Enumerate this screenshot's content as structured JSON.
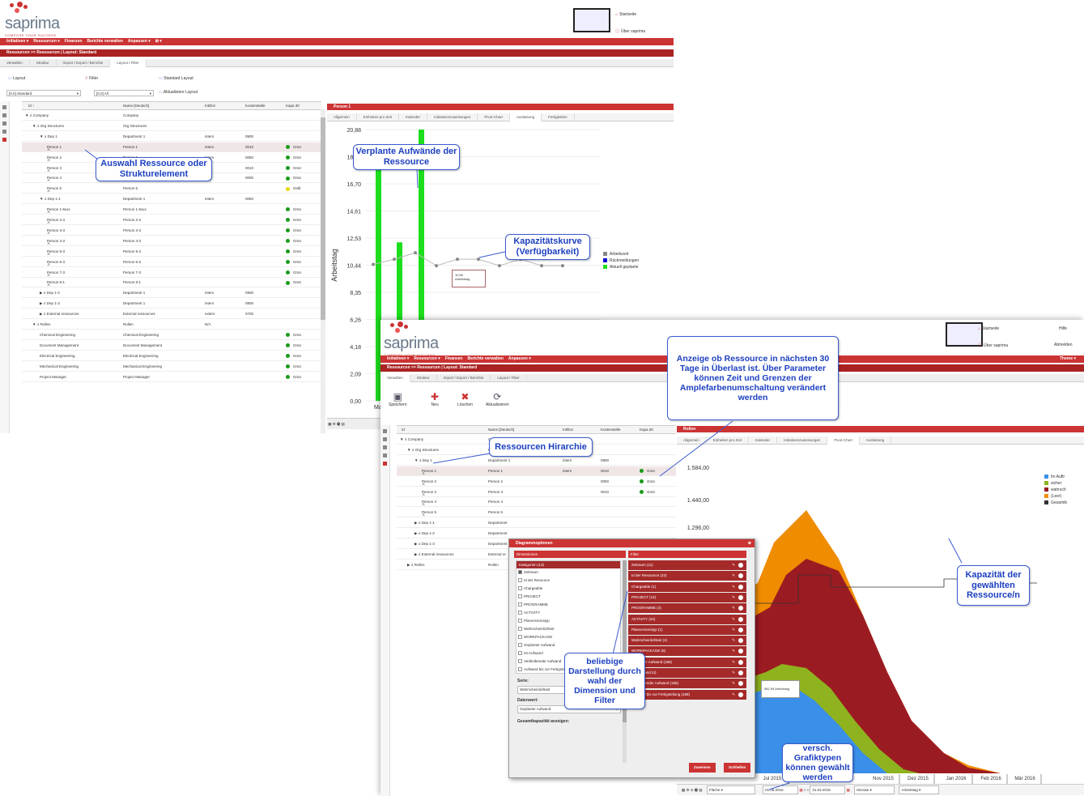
{
  "logo": {
    "word": "saprima",
    "tagline": "COMPOSE YOUR SUCCESS"
  },
  "win1": {
    "top_links": {
      "start": "Startseite",
      "about": "Über saprima"
    },
    "menu": [
      "Initiativen ▾",
      "Ressourcen ▾",
      "Finanzen",
      "Berichte verwalten",
      "Anpassen ▾",
      "⊞ ▾"
    ],
    "breadcrumb": "Ressourcen >> Ressourcen | Layout: Standard",
    "tabs": [
      "Verwalten",
      "Struktur",
      "Import / Export / Berichte",
      "Layout / Filter"
    ],
    "toolbar": {
      "layout": "Layout",
      "filter": "Filter",
      "standard": "Standard Layout",
      "layout_value": "[0,0] Standard",
      "filter_value": "[0,0] All",
      "refresh": "Aktualisiere Layout"
    },
    "columns": [
      "Id ↑",
      "Name [Deutsch]",
      "Int/Ext",
      "Kostenstelle",
      "Kapa 30"
    ],
    "rows": [
      {
        "id": "▼ ⅄ Company",
        "name": "Company",
        "ie": "",
        "ks": "",
        "kapa": "",
        "c": "",
        "lvl": 0
      },
      {
        "id": "▼ ⅄ Org Structures",
        "name": "Org Structures",
        "ie": "",
        "ks": "",
        "kapa": "",
        "c": "",
        "lvl": 1
      },
      {
        "id": "▼ ⅄ Dep 1",
        "name": "Department 1",
        "ie": "intern",
        "ks": "0900",
        "kapa": "",
        "c": "",
        "lvl": 2
      },
      {
        "id": "Person 1",
        "name": "Person 1",
        "ie": "intern",
        "ks": "0010",
        "kapa": "Grün",
        "c": "#1a9a1a",
        "lvl": 3
      },
      {
        "id": "Person 2",
        "name": "Person 2",
        "ie": "intern",
        "ks": "0050",
        "kapa": "Grün",
        "c": "#1a9a1a",
        "lvl": 3
      },
      {
        "id": "Person 3",
        "name": "Person 3",
        "ie": "",
        "ks": "0010",
        "kapa": "Grün",
        "c": "#1a9a1a",
        "lvl": 3
      },
      {
        "id": "Person 4",
        "name": "Person 4",
        "ie": "",
        "ks": "0000",
        "kapa": "Grün",
        "c": "#1a9a1a",
        "lvl": 3
      },
      {
        "id": "Person 5",
        "name": "Person 5",
        "ie": "",
        "ks": "",
        "kapa": "Gelb",
        "c": "#e8d800",
        "lvl": 3
      },
      {
        "id": "▼ ⅄ Dep 1-1",
        "name": "Department 1",
        "ie": "intern",
        "ks": "0050",
        "kapa": "",
        "c": "",
        "lvl": 2
      },
      {
        "id": "Person 1-5xxx",
        "name": "Person 1-5xxx",
        "ie": "",
        "ks": "",
        "kapa": "Grün",
        "c": "#1a9a1a",
        "lvl": 3
      },
      {
        "id": "Person 2-3",
        "name": "Person 2-3",
        "ie": "",
        "ks": "",
        "kapa": "Grün",
        "c": "#1a9a1a",
        "lvl": 3
      },
      {
        "id": "Person 3-3",
        "name": "Person 3-3",
        "ie": "",
        "ks": "",
        "kapa": "Grün",
        "c": "#1a9a1a",
        "lvl": 3
      },
      {
        "id": "Person 4-3",
        "name": "Person 4-3",
        "ie": "",
        "ks": "",
        "kapa": "Grün",
        "c": "#1a9a1a",
        "lvl": 3
      },
      {
        "id": "Person 5-3",
        "name": "Person 5-3",
        "ie": "",
        "ks": "",
        "kapa": "Grün",
        "c": "#1a9a1a",
        "lvl": 3
      },
      {
        "id": "Person 6-3",
        "name": "Person 6-3",
        "ie": "",
        "ks": "",
        "kapa": "Grün",
        "c": "#1a9a1a",
        "lvl": 3
      },
      {
        "id": "Person 7-3",
        "name": "Person 7-3",
        "ie": "",
        "ks": "",
        "kapa": "Grün",
        "c": "#1a9a1a",
        "lvl": 3
      },
      {
        "id": "Person 8-1",
        "name": "Person 8-1",
        "ie": "",
        "ks": "",
        "kapa": "Grün",
        "c": "#1a9a1a",
        "lvl": 3
      },
      {
        "id": "▶ ⅄ Dep 1-2",
        "name": "Department 1",
        "ie": "intern",
        "ks": "0900",
        "kapa": "",
        "c": "",
        "lvl": 2
      },
      {
        "id": "▶ ⅄ Dep 1-3",
        "name": "Department 1",
        "ie": "intern",
        "ks": "0800",
        "kapa": "",
        "c": "",
        "lvl": 2
      },
      {
        "id": "▶ ⅄ External ressources",
        "name": "External ressources",
        "ie": "extern",
        "ks": "0700",
        "kapa": "",
        "c": "",
        "lvl": 2
      },
      {
        "id": "▼ ⅄ Rollen",
        "name": "Rollen",
        "ie": "N/A",
        "ks": "",
        "kapa": "",
        "c": "",
        "lvl": 1
      },
      {
        "id": "Chemical Engineering",
        "name": "Chemical Engineering",
        "ie": "",
        "ks": "",
        "kapa": "Grün",
        "c": "#1a9a1a",
        "lvl": 2
      },
      {
        "id": "Document Management",
        "name": "Document Management",
        "ie": "",
        "ks": "",
        "kapa": "Grün",
        "c": "#1a9a1a",
        "lvl": 2
      },
      {
        "id": "Electrical Engineering",
        "name": "Electrical Engineering",
        "ie": "",
        "ks": "",
        "kapa": "Grün",
        "c": "#1a9a1a",
        "lvl": 2
      },
      {
        "id": "Mechanical Engineering",
        "name": "Mechanical Engineering",
        "ie": "",
        "ks": "",
        "kapa": "Grün",
        "c": "#1a9a1a",
        "lvl": 2
      },
      {
        "id": "Project Manager",
        "name": "Project Manager",
        "ie": "",
        "ks": "",
        "kapa": "Grün",
        "c": "#1a9a1a",
        "lvl": 2
      }
    ],
    "panel_title": "Person 1",
    "chart_tabs": [
      "Allgemein",
      "Einheiten pro Zeit",
      "Kalender",
      "Initiativenzuweisungen",
      "Pivot-Chart",
      "Auslastung",
      "Fertigkeiten"
    ],
    "chart_ylabel": "Arbeitstag",
    "chart_xtick": "Mai 2015",
    "tooltip": {
      "value": "10,50",
      "unit": "Arbeitstag"
    },
    "legend": [
      {
        "label": "Arbeitszeit",
        "color": "#888888"
      },
      {
        "label": "Rückmeldungen",
        "color": "#1010d0"
      },
      {
        "label": "Aktuell geplante",
        "color": "#22dd22"
      }
    ]
  },
  "chart_data": [
    {
      "type": "bar",
      "title": "",
      "ylabel": "Arbeitstag",
      "ylim": [
        0,
        20.88
      ],
      "yticks": [
        "20,88",
        "18,79",
        "16,70",
        "14,61",
        "12,53",
        "10,44",
        "8,35",
        "6,26",
        "4,18",
        "2,09",
        "0,00"
      ],
      "categories": [
        "Mai 2015"
      ],
      "series": [
        {
          "name": "Aktuell geplante",
          "values": [
            18.8,
            12.2,
            20.88
          ]
        },
        {
          "name": "Arbeitszeit",
          "values": [
            10.5,
            10.9,
            11.4,
            10.4,
            10.9,
            10.9,
            10.4,
            10.9,
            10.4,
            10.4
          ]
        }
      ]
    },
    {
      "type": "area",
      "ylim": [
        0,
        1584
      ],
      "yticks": [
        "1.584,00",
        "1.440,00",
        "1.296,00"
      ],
      "categories": [
        "Jul 2015",
        "Nov 2015",
        "Dez 2015",
        "Jan 2016",
        "Feb 2016",
        "Mär 2016"
      ],
      "series": [
        {
          "name": "Im Auftr",
          "color": "#3a8fe8"
        },
        {
          "name": "sicher",
          "color": "#8fb21f"
        },
        {
          "name": "wahrsch",
          "color": "#9b1b22"
        },
        {
          "name": "(Leer)",
          "color": "#f08c00"
        },
        {
          "name": "Gesamtk",
          "color": "#333333"
        }
      ],
      "tooltip": "582,99 Arbeitstag"
    }
  ],
  "win2": {
    "top_links": {
      "start": "Startseite",
      "about": "Über saprima",
      "help": "Hilfe",
      "logout": "Abmelden",
      "theme": "Theme ▾"
    },
    "menu": [
      "Initiativen ▾",
      "Ressourcen ▾",
      "Finanzen",
      "Berichte verwalten",
      "Anpassen ▾"
    ],
    "breadcrumb": "Ressourcen >> Ressourcen | Layout: Standard",
    "tabs": [
      "Verwalten",
      "Struktur",
      "Import / Export / Berichte",
      "Layout / Filter"
    ],
    "toolbar": [
      "Speichern",
      "Neu",
      "Löschen",
      "Aktualisieren"
    ],
    "columns": [
      "Id",
      "Name [Deutsch]",
      "Int/Ext",
      "Kostenstelle",
      "Kapa 30"
    ],
    "rows": [
      {
        "id": "▼ ⅄ Company",
        "name": "Company",
        "ie": "",
        "ks": "",
        "kapa": "",
        "c": "",
        "lvl": 0
      },
      {
        "id": "▼ ⅄ Org Structures",
        "name": "Org Structures",
        "ie": "",
        "ks": "",
        "kapa": "",
        "c": "",
        "lvl": 1
      },
      {
        "id": "▼ ⅄ Dep 1",
        "name": "Department 1",
        "ie": "intern",
        "ks": "0900",
        "kapa": "",
        "c": "",
        "lvl": 2
      },
      {
        "id": "Person 1",
        "name": "Person 1",
        "ie": "intern",
        "ks": "0010",
        "kapa": "Grün",
        "c": "#1a9a1a",
        "lvl": 3
      },
      {
        "id": "Person 2",
        "name": "Person 2",
        "ie": "",
        "ks": "0050",
        "kapa": "Grün",
        "c": "#1a9a1a",
        "lvl": 3
      },
      {
        "id": "Person 3",
        "name": "Person 3",
        "ie": "",
        "ks": "0010",
        "kapa": "Grün",
        "c": "#1a9a1a",
        "lvl": 3
      },
      {
        "id": "Person 4",
        "name": "Person 4",
        "ie": "",
        "ks": "",
        "kapa": "",
        "c": "",
        "lvl": 3
      },
      {
        "id": "Person 5",
        "name": "Person 5",
        "ie": "",
        "ks": "",
        "kapa": "",
        "c": "",
        "lvl": 3
      },
      {
        "id": "▶ ⅄ Dep 1-1",
        "name": "Department",
        "ie": "",
        "ks": "",
        "kapa": "",
        "c": "",
        "lvl": 2
      },
      {
        "id": "▶ ⅄ Dep 1-2",
        "name": "Department",
        "ie": "",
        "ks": "",
        "kapa": "",
        "c": "",
        "lvl": 2
      },
      {
        "id": "▶ ⅄ Dep 1-3",
        "name": "Department",
        "ie": "",
        "ks": "",
        "kapa": "",
        "c": "",
        "lvl": 2
      },
      {
        "id": "▶ ⅄ External ressources",
        "name": "External re",
        "ie": "",
        "ks": "",
        "kapa": "",
        "c": "",
        "lvl": 2
      },
      {
        "id": "▶ ⅄ Rollen",
        "name": "Rollen",
        "ie": "",
        "ks": "",
        "kapa": "",
        "c": "",
        "lvl": 1
      }
    ],
    "panel_title": "Rollen",
    "chart_tabs": [
      "Allgemein",
      "Einheiten pro Zeit",
      "Kalender",
      "Initiativenzuweisungen",
      "Pivot-Chart",
      "Auslastung"
    ],
    "bottom": {
      "chart_type": "Fläche",
      "from": "01.05.2015",
      "to": "31.03.2016",
      "unit": "Monate",
      "measure": "Arbeitstag"
    }
  },
  "dialog": {
    "title": "Diagrammoptionen",
    "dimensions": "Dimensionen",
    "filter": "Filter",
    "categories": "Kategorien (13)",
    "cat_items": [
      {
        "label": "Zeitraum",
        "checked": true
      },
      {
        "label": "Id der Resource",
        "checked": false
      },
      {
        "label": "Chargeable",
        "checked": false
      },
      {
        "label": "PROJECT",
        "checked": false
      },
      {
        "label": "PROGRAMME",
        "checked": false
      },
      {
        "label": "ACTIVITY",
        "checked": false
      },
      {
        "label": "Planversionstyp",
        "checked": false
      },
      {
        "label": "Wahrscheinlichkeit",
        "checked": false
      },
      {
        "label": "WORKPACKAGE",
        "checked": false
      },
      {
        "label": "Geplanter Aufwand",
        "checked": false
      },
      {
        "label": "Ist-Aufwand",
        "checked": false
      },
      {
        "label": "Verbleibender Aufwand",
        "checked": false
      },
      {
        "label": "Aufwand bis zur Fertigstellung",
        "checked": false
      }
    ],
    "filters": [
      "Zeitraum (11)",
      "Id der Ressource (22)",
      "Chargeable (1)",
      "PROJECT (12)",
      "PROGRAMME (4)",
      "ACTIVITY (22)",
      "Planversionstyp (1)",
      "Wahrscheinlichkeit (4)",
      "WORKPACKAGE (6)",
      "Geplanter Aufwand (185)",
      "Ist-Aufwand (4)",
      "Verbleibender Aufwand (185)",
      "Aufwand bis zur Fertigstellung (188)"
    ],
    "serie_label": "Serie:",
    "serie_value": "Wahrscheinlichkeit",
    "datenwert_label": "Datenwert:",
    "datenwert_value": "Geplanter Aufwand",
    "gesamt": "Gesamtkapazität anzeigen:",
    "zuweisen": "Zuweisen",
    "schliessen": "Schließen"
  },
  "callouts": {
    "c1": "Auswahl Ressource oder Strukturelement",
    "c2": "Verplante Aufwände der Ressource",
    "c3": "Kapazitätskurve (Verfügbarkeit)",
    "c4": "Anzeige ob Ressource in nächsten 30 Tage  in Überlast ist. Über Parameter können Zeit und Grenzen der Amplefarbenumschaltung verändert werden",
    "c5": "Ressourcen Hirarchie",
    "c6": "Kapazität der gewählten Ressource/n",
    "c7": "beliebige Darstellung durch wahl der Dimension und Filter",
    "c8": "versch. Grafiktypen können gewählt werden"
  }
}
